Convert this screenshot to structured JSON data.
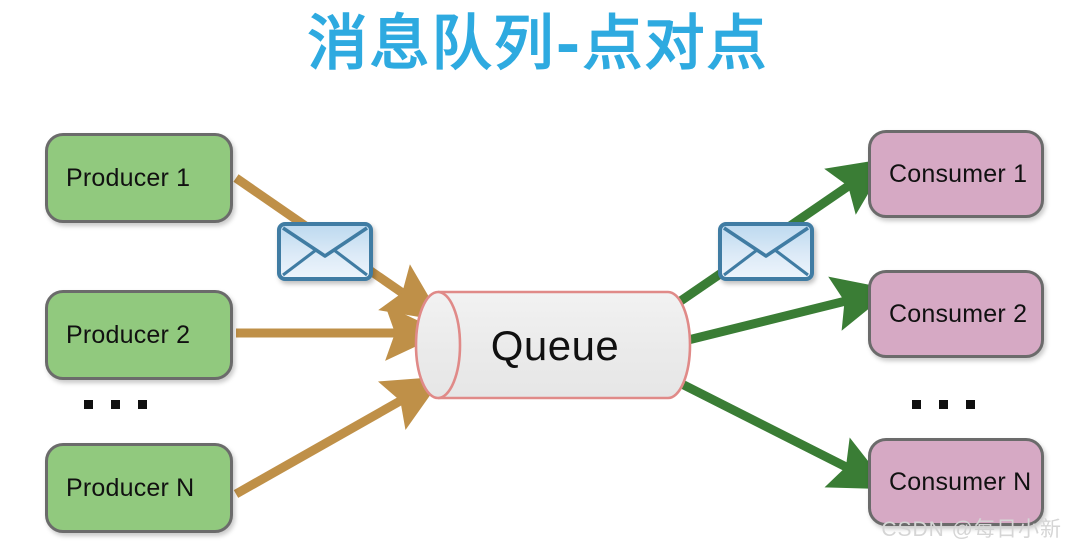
{
  "title": "消息队列-点对点",
  "queue": {
    "label": "Queue"
  },
  "producers": [
    {
      "label": "Producer 1"
    },
    {
      "label": "Producer 2"
    },
    {
      "label": "Producer N"
    }
  ],
  "consumers": [
    {
      "label": "Consumer 1"
    },
    {
      "label": "Consumer 2"
    },
    {
      "label": "Consumer N"
    }
  ],
  "ellipsis": {
    "producers": "...",
    "consumers": "..."
  },
  "icons": {
    "envelope_left": "envelope-icon",
    "envelope_right": "envelope-icon"
  },
  "watermark": "CSDN @每日小新",
  "colors": {
    "title": "#2eaae0",
    "producer_fill": "#91c97e",
    "consumer_fill": "#d6a9c4",
    "node_border": "#6b6b6b",
    "queue_fill": "#ededed",
    "queue_border": "#e08a88",
    "producer_arrow": "#bf9048",
    "consumer_arrow": "#3a7d35",
    "envelope_fill": "#cfe3f3",
    "envelope_border": "#3f7ba3",
    "watermark": "#d5d5d5",
    "background": "#ffffff"
  }
}
